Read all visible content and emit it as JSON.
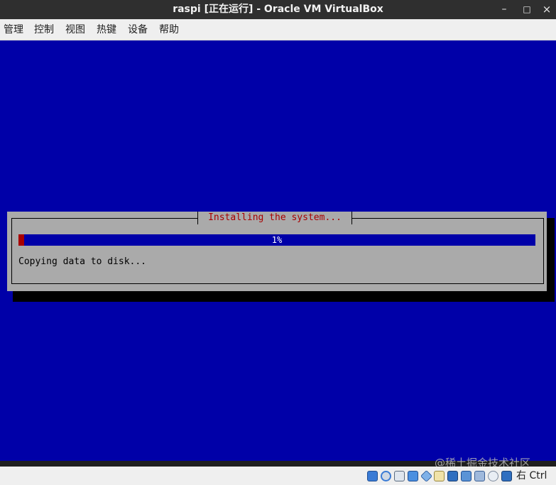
{
  "window": {
    "title": "raspi [正在运行] - Oracle VM VirtualBox",
    "controls": {
      "minimize": "–",
      "maximize": "□",
      "close": "×"
    }
  },
  "menu": {
    "items": [
      "管理",
      "控制",
      "视图",
      "热键",
      "设备",
      "帮助"
    ]
  },
  "installer": {
    "dialog_title": "Installing the system...",
    "progress_label": "1%",
    "progress_value": 0.01,
    "status": "Copying data to disk..."
  },
  "colors": {
    "screen_bg": "#0000a8",
    "dialog_bg": "#aaaaaa",
    "title_red": "#a80000",
    "progress_fill": "#a80000"
  },
  "statusbar": {
    "icons": [
      "hard-disk-icon",
      "optical-disk-icon",
      "audio-icon",
      "network-icon",
      "usb-icon",
      "shared-folder-icon",
      "display-icon",
      "recording-icon",
      "virtualization-icon",
      "mouse-integration-icon",
      "keyboard-capture-icon"
    ],
    "host_key_label": "右 Ctrl"
  },
  "watermark": "@稀土掘金技术社区"
}
